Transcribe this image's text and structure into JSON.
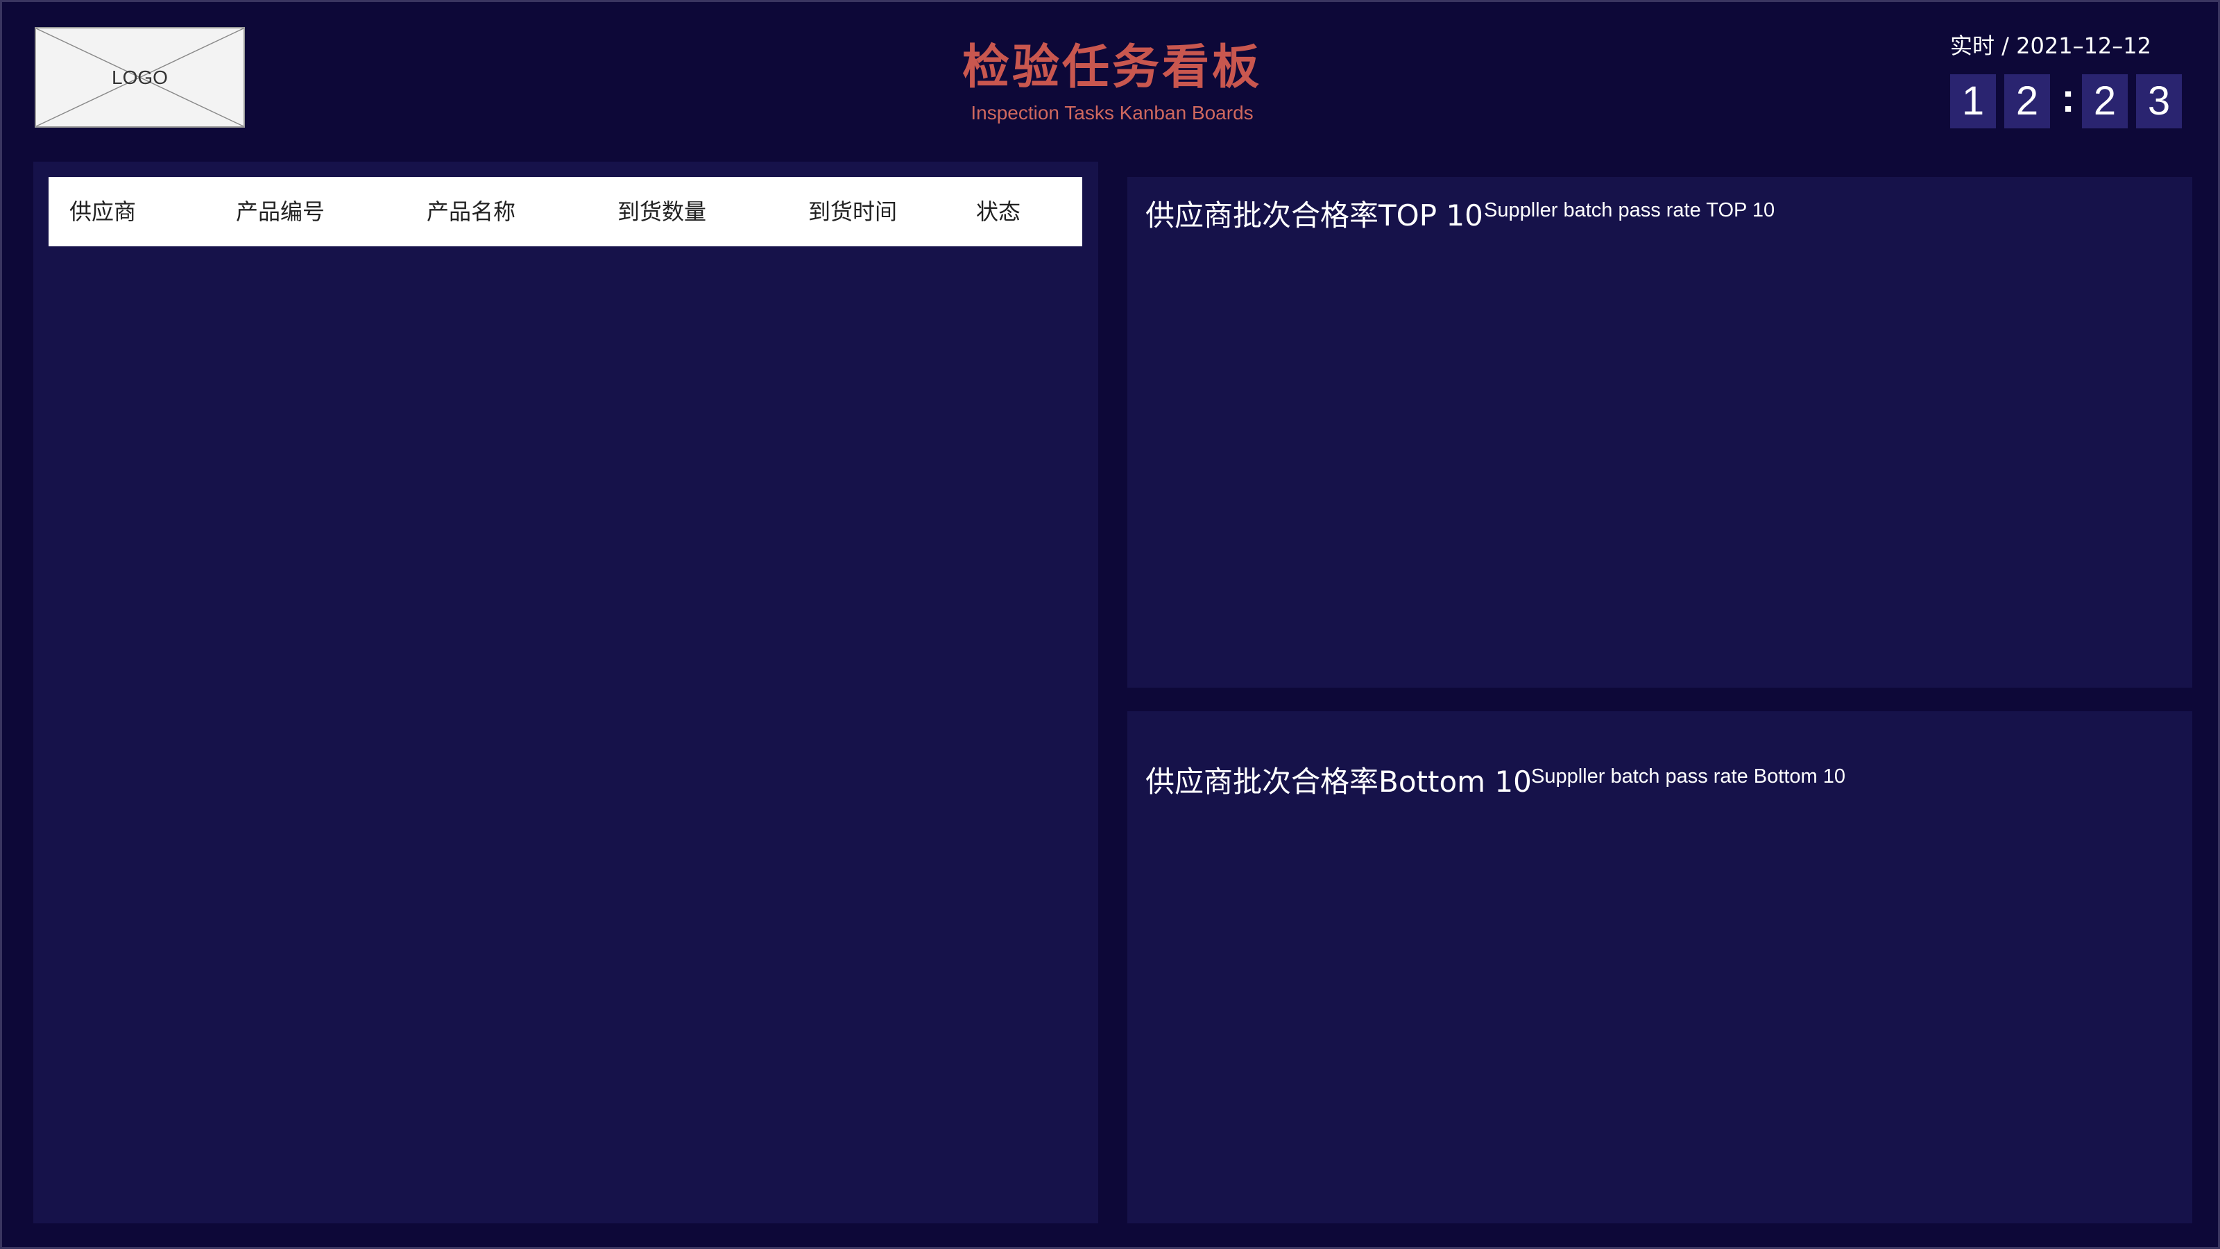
{
  "header": {
    "logo_text": "LOGO",
    "title": "检验任务看板",
    "subtitle": "Inspection Tasks Kanban Boards",
    "datetime_label": "实时 / 2021–12–12",
    "clock": {
      "d1": "1",
      "d2": "2",
      "sep": ":",
      "d3": "2",
      "d4": "3"
    }
  },
  "table": {
    "columns": [
      "供应商",
      "产品编号",
      "产品名称",
      "到货数量",
      "到货时间",
      "状态"
    ],
    "rows": []
  },
  "panels": {
    "top": {
      "title": "供应商批次合格率TOP 10",
      "subtitle": "Suppller  batch pass rate TOP 10"
    },
    "bottom": {
      "title": "供应商批次合格率Bottom 10",
      "subtitle": "Suppller  batch pass rate Bottom 10"
    }
  },
  "colors": {
    "background": "#0d0838",
    "panel": "#16124a",
    "title": "#c9574f",
    "digit_box": "#2a2470"
  }
}
